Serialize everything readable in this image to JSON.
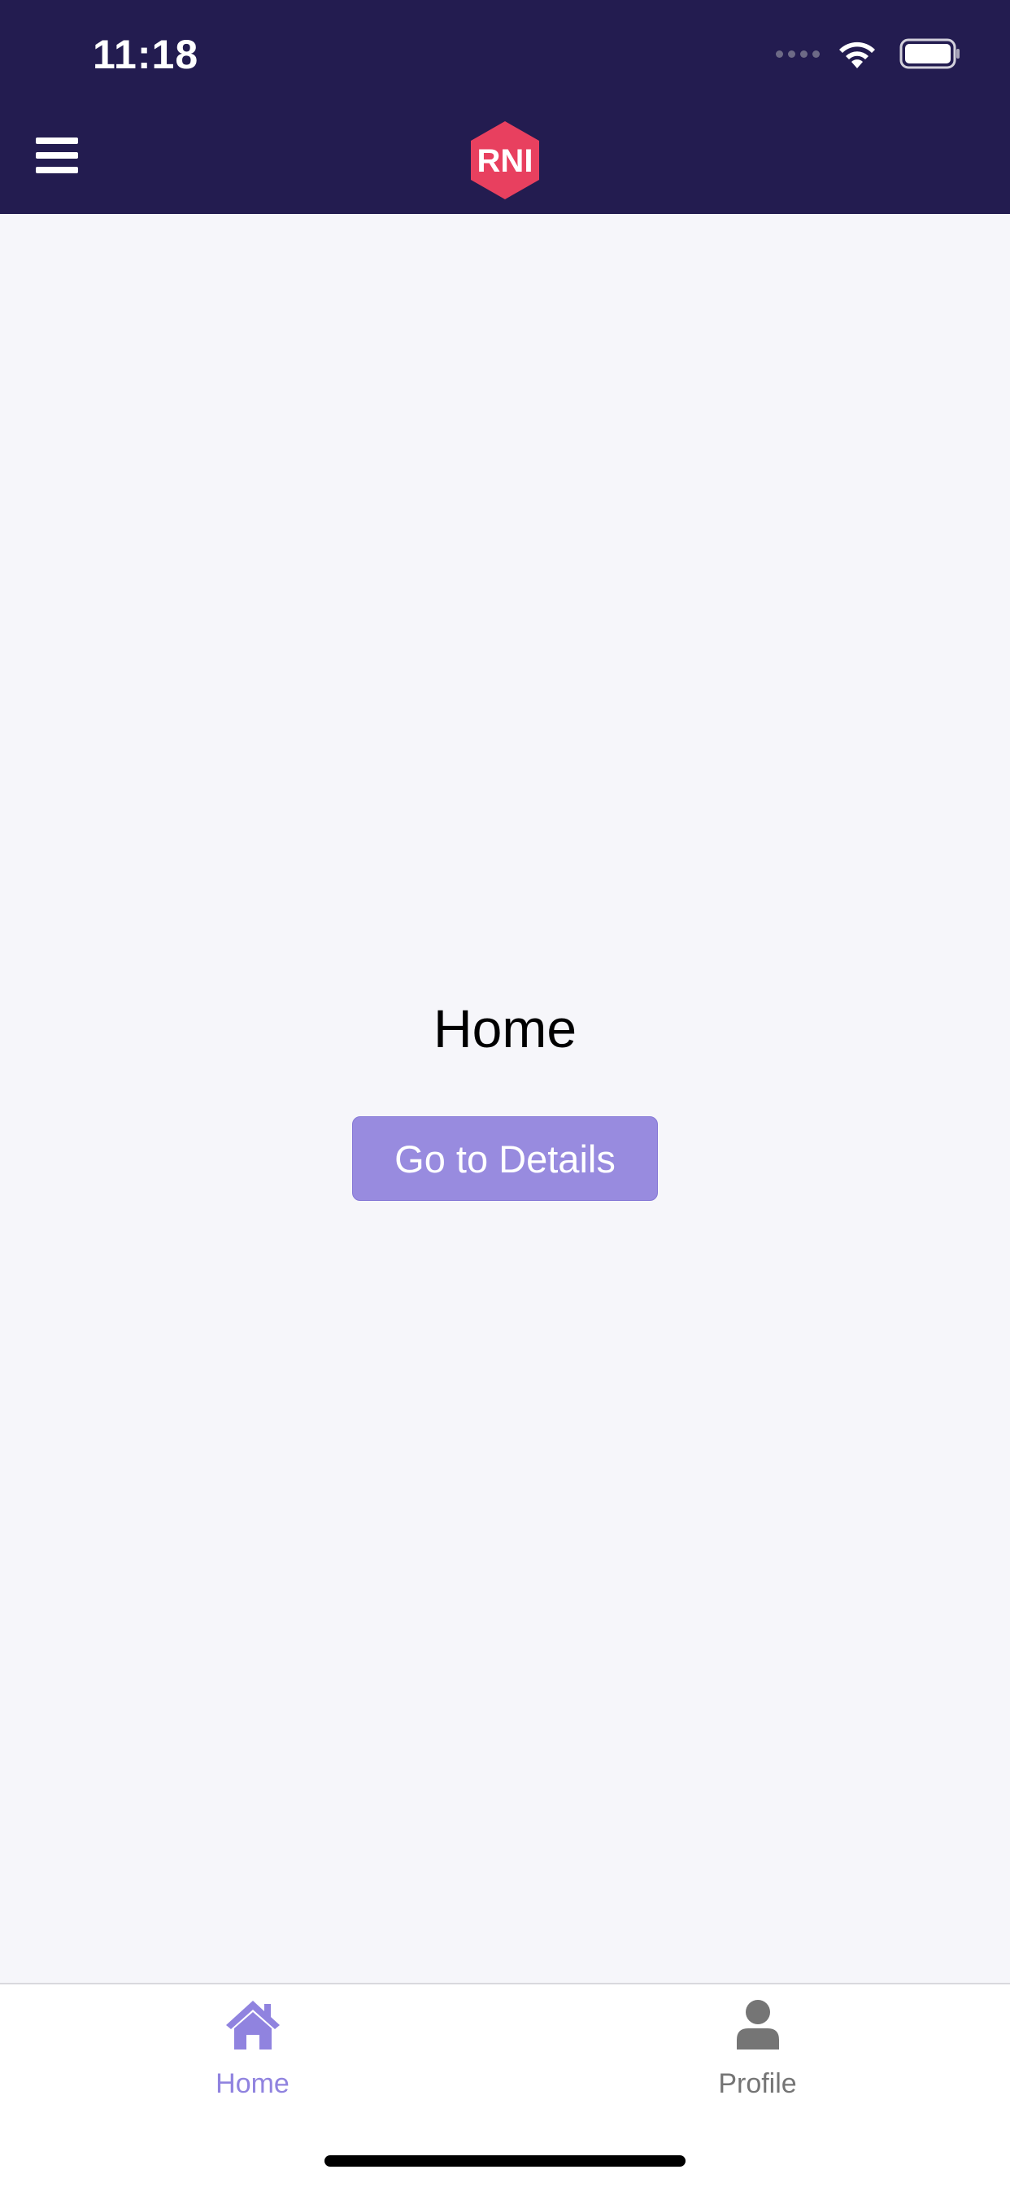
{
  "status_bar": {
    "time": "11:18"
  },
  "header": {
    "logo_text": "RNI",
    "logo_color": "#e8405f",
    "background_color": "#231c50",
    "menu_icon": "hamburger-menu-icon"
  },
  "main": {
    "title": "Home",
    "button_label": "Go to Details",
    "button_color": "#988bdf"
  },
  "tabbar": {
    "tabs": [
      {
        "label": "Home",
        "icon": "home-icon",
        "active": true,
        "color": "#9083df"
      },
      {
        "label": "Profile",
        "icon": "person-icon",
        "active": false,
        "color": "#757575"
      }
    ]
  }
}
